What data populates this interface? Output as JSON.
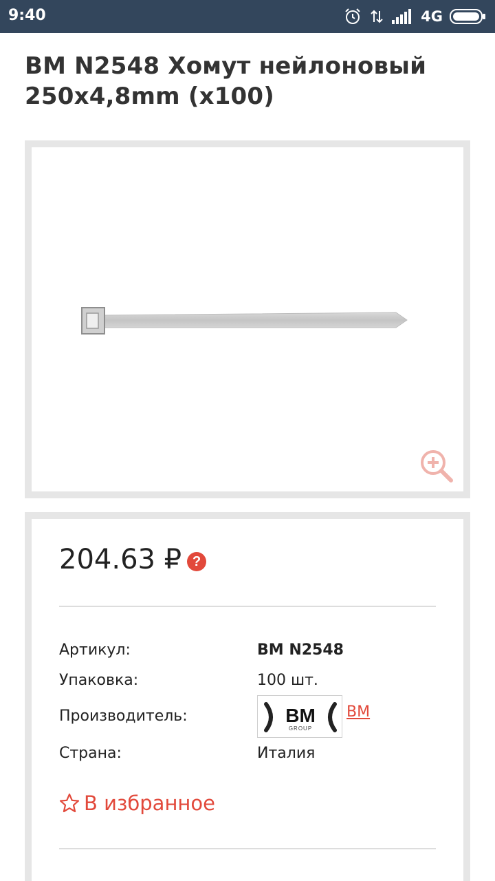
{
  "status_bar": {
    "time": "9:40",
    "network": "4G",
    "icons": [
      "alarm-icon",
      "data-transfer-icon",
      "signal-icon",
      "battery-icon"
    ]
  },
  "product": {
    "title": "BM N2548 Хомут нейлоновый 250x4,8mm (x100)",
    "image_icon": "cable-tie-image",
    "zoom_icon": "zoom-in-icon"
  },
  "pricing": {
    "price": "204.63 ₽",
    "help_symbol": "?"
  },
  "specs": {
    "article_label": "Артикул:",
    "article_value": "BM N2548",
    "package_label": "Упаковка:",
    "package_value": "100 шт.",
    "manufacturer_label": "Производитель:",
    "manufacturer_link": "BM",
    "manufacturer_logo_text": "BM",
    "manufacturer_logo_subtext": "GROUP",
    "country_label": "Страна:",
    "country_value": "Италия"
  },
  "favorites": {
    "label": "В избранное",
    "icon": "star-outline-icon"
  },
  "colors": {
    "accent": "#e2493b",
    "status_bar": "#33465c",
    "frame": "#e6e6e6"
  }
}
